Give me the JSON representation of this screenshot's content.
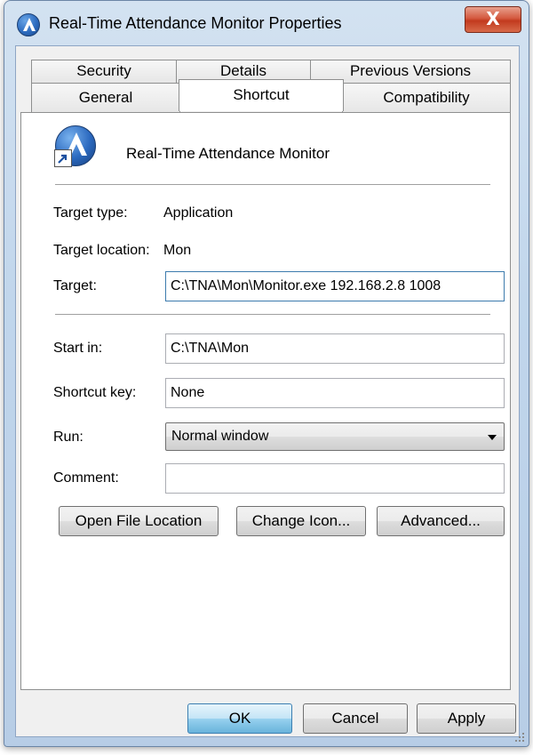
{
  "window": {
    "title": "Real-Time Attendance Monitor Properties",
    "close_glyph": "X"
  },
  "tabs": {
    "row1": [
      "Security",
      "Details",
      "Previous Versions"
    ],
    "row2": [
      "General",
      "Shortcut",
      "Compatibility"
    ],
    "active": "Shortcut"
  },
  "shortcut": {
    "name": "Real-Time Attendance Monitor",
    "target_type_label": "Target type:",
    "target_type_value": "Application",
    "target_location_label": "Target location:",
    "target_location_value": "Mon",
    "target_label": "Target:",
    "target_value": "C:\\TNA\\Mon\\Monitor.exe 192.168.2.8 1008",
    "start_in_label": "Start in:",
    "start_in_value": "C:\\TNA\\Mon",
    "shortcut_key_label": "Shortcut key:",
    "shortcut_key_value": "None",
    "run_label": "Run:",
    "run_value": "Normal window",
    "comment_label": "Comment:",
    "comment_value": ""
  },
  "actions": {
    "open_file_location": "Open File Location",
    "change_icon": "Change Icon...",
    "advanced": "Advanced..."
  },
  "footer": {
    "ok": "OK",
    "cancel": "Cancel",
    "apply": "Apply"
  },
  "colors": {
    "accent": "#3c7fb1",
    "title_bar": "#c1d6ec",
    "close_button": "#c23a1e"
  }
}
